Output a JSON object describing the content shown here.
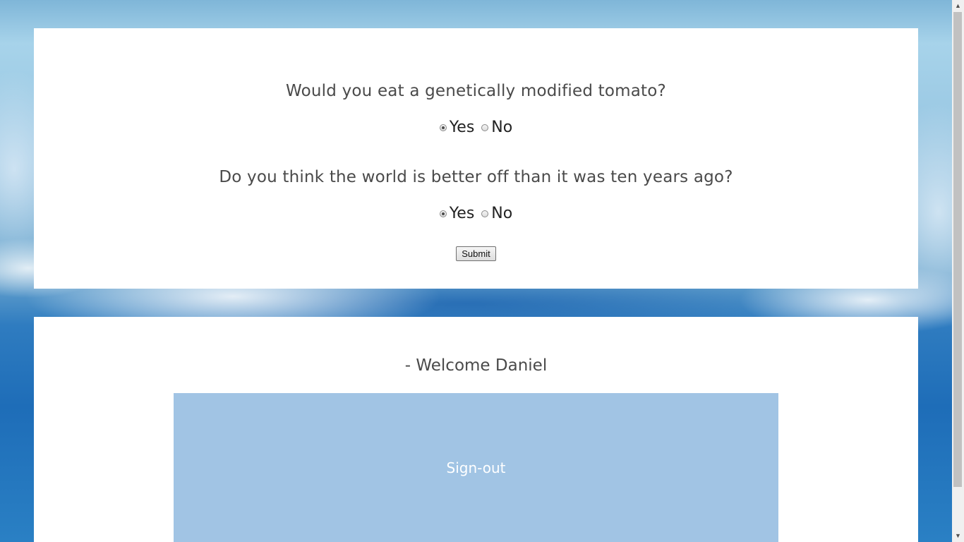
{
  "survey": {
    "questions": [
      {
        "text": "Would you eat a genetically modified tomato?",
        "options": [
          {
            "label": "Yes",
            "checked": true
          },
          {
            "label": "No",
            "checked": false
          }
        ]
      },
      {
        "text": "Do you think the world is better off than it was ten years ago?",
        "options": [
          {
            "label": "Yes",
            "checked": true
          },
          {
            "label": "No",
            "checked": false
          }
        ]
      }
    ],
    "submit_label": "Submit"
  },
  "welcome": {
    "greeting": "- Welcome Daniel",
    "signout_label": "Sign-out"
  },
  "scrollbar": {
    "up_icon": "arrow-up-icon",
    "down_icon": "arrow-down-icon"
  },
  "colors": {
    "signout_bg": "#a1c4e4",
    "card_bg": "#ffffff",
    "text": "#4a4a4a"
  }
}
